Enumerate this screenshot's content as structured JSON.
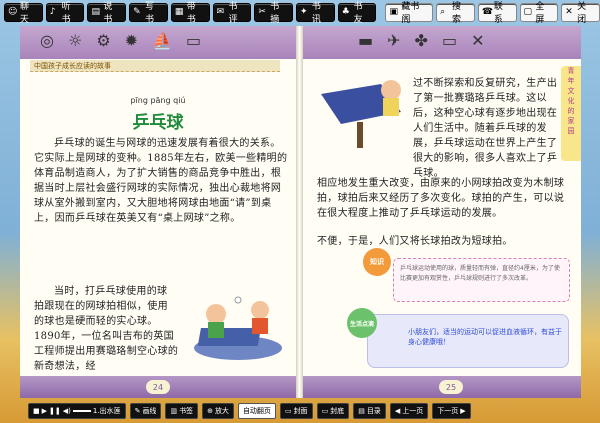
{
  "toolbar": {
    "items": [
      "聊天",
      "听书",
      "说书",
      "写书",
      "带书",
      "书评",
      "书摘",
      "书讯",
      "书友"
    ],
    "right": [
      "藏书阁",
      "搜索",
      "联系",
      "全屏",
      "关闭"
    ]
  },
  "book": {
    "header_title": "中国孩子成长应读的故事",
    "title_pinyin": "pīng pāng qiú",
    "title": "乒乓球",
    "left_paragraphs": [
      "乒乓球的诞生与网球的迅速发展有着很大的关系。它实际上是网球的变种。1885年左右，欧美一些精明的体育品制造商人，为了扩大销售的商品竞争中胜出，根据当时上层社会盛行网球的实际情况，独出心裁地将网球从室外搬到室内，又大胆地将网球由地面“请”到桌上，因而乒乓球在英美又有“桌上网球”之称。",
      "当时，打乒乓球使用的球拍跟现在的网球拍相似，使用的球也是硬而轻的实心球。",
      "1890年，一位名叫吉布的英国工程师提出用赛璐珞制空心球的新奇想法，经"
    ],
    "right_paragraphs": [
      "过不断探索和反复研究，生产出了第一批赛璐珞乒乓球。这以后，这种空心球有逐步地出现在人们生活中。随着乒乓球的发展，乒乓球运动在世界上产生了很大的影响，很多人喜欢上了乒乓球。",
      "相应地发生重大改变，由原来的小网球拍改变为木制球拍，球拍后来又经历了多次变化。球拍的产生，可以说在很大程度上推动了乒乓球运动的发展。",
      "不便，于是，人们又将长球拍改为短球拍。"
    ],
    "knowledge_label": "知识",
    "knowledge_text": "乒乓球运动使用的球，质量轻而有弹，直径约4厘米，为了使比赛更加有观赏性，乒乓球规则进行了多次改革。",
    "life_label": "生活点滴",
    "life_text": "小朋友们，适当的运动可以促进血液循环，有益于身心健康哦！",
    "side_tab": [
      "青",
      "年",
      "文",
      "化",
      "的",
      "家",
      "园"
    ],
    "left_page_no": "24",
    "right_page_no": "25"
  },
  "bottom": {
    "voice": "1.出水莲",
    "items": [
      "画线",
      "书签",
      "放大",
      "自动翻页",
      "封面",
      "封底",
      "目录",
      "上一页",
      "下一页"
    ]
  }
}
